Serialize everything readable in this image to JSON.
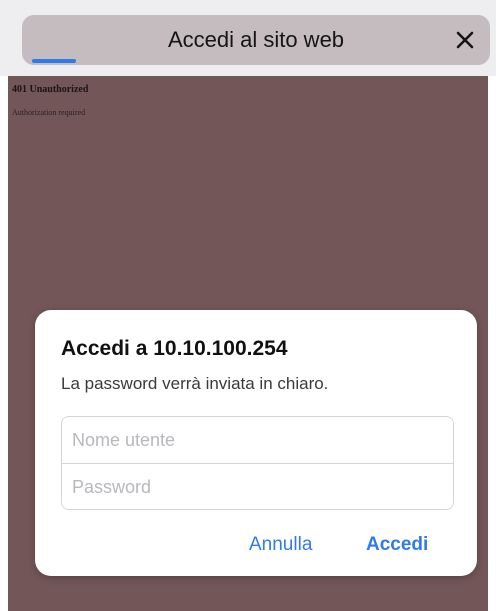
{
  "header": {
    "title": "Accedi al sito web",
    "close_icon": "close-icon",
    "progress_color": "#2f7bea"
  },
  "page": {
    "heading": "401 Unauthorized",
    "subtext": "Authorization required"
  },
  "dialog": {
    "title": "Accedi a 10.10.100.254",
    "message": "La password verrà inviata in chiaro.",
    "username": {
      "value": "",
      "placeholder": "Nome utente"
    },
    "password": {
      "value": "",
      "placeholder": "Password"
    },
    "cancel_label": "Annulla",
    "login_label": "Accedi"
  },
  "colors": {
    "accent": "#2f7bea",
    "overlay_background": "#735758",
    "title_pill": "#c5bcc0"
  }
}
